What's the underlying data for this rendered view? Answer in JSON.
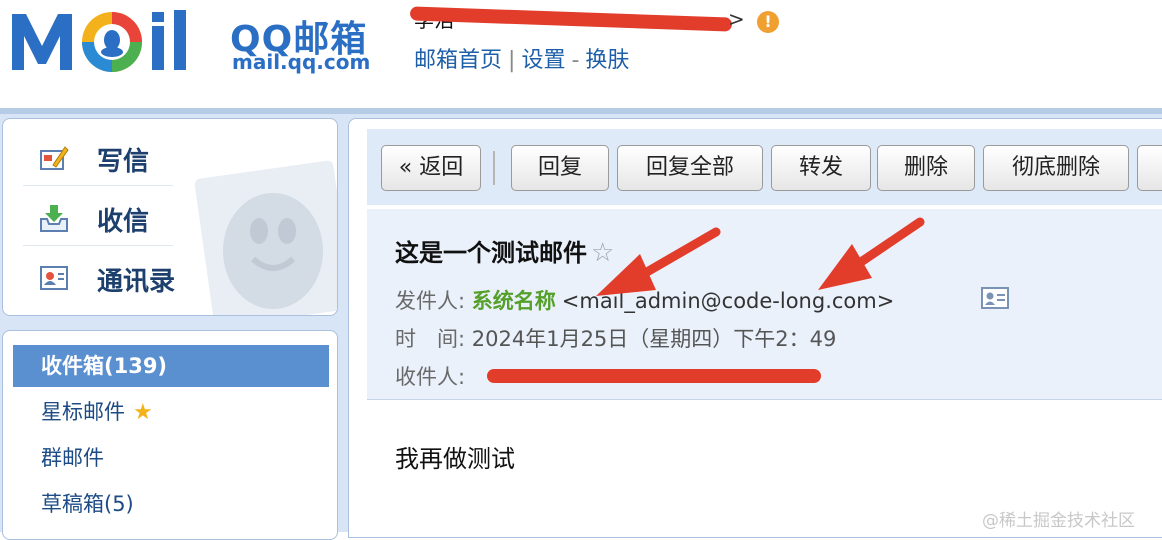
{
  "header": {
    "brand_qq": "QQ邮箱",
    "brand_domain": "mail.qq.com",
    "account_name": "李浩",
    "account_arrow": ">",
    "warn_icon": "!",
    "links": [
      "邮箱首页",
      "设置",
      "换肤"
    ],
    "link_sep_1": "|",
    "link_sep_2": "-"
  },
  "sidebar": {
    "quick": [
      {
        "label": "写信",
        "icon": "compose-icon"
      },
      {
        "label": "收信",
        "icon": "inbox-download-icon"
      },
      {
        "label": "通讯录",
        "icon": "contacts-icon"
      }
    ],
    "folders": [
      {
        "label": "收件箱(139)",
        "active": true
      },
      {
        "label": "星标邮件",
        "star": "★"
      },
      {
        "label": "群邮件"
      },
      {
        "label": "草稿箱(5)"
      }
    ]
  },
  "toolbar": {
    "buttons": [
      "« 返回",
      "回复",
      "回复全部",
      "转发",
      "删除",
      "彻底删除"
    ]
  },
  "mail": {
    "subject": "这是一个测试邮件",
    "subject_star": "☆",
    "sender_label": "发件人:",
    "sender_name": "系统名称",
    "sender_addr": "<mail_admin@code-long.com>",
    "time_label": "时　间:",
    "time_value": "2024年1月25日（星期四）下午2：49",
    "recipient_label": "收件人:",
    "body": "我再做测试"
  },
  "colors": {
    "brand_blue": "#2a6fc4",
    "sender_green": "#55a02a",
    "annotation_red": "#e23c2b",
    "active_folder": "#5a8fd0"
  },
  "watermark": "@稀土掘金技术社区"
}
